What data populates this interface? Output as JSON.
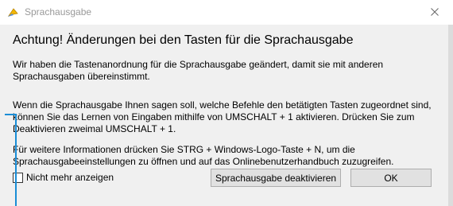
{
  "window": {
    "title": "Sprachausgabe",
    "icon": "narrator-app-icon",
    "close_icon": "close-icon"
  },
  "dialog": {
    "heading": "Achtung! Änderungen bei den Tasten für die Sprachausgabe",
    "paragraph1": "Wir haben die Tastenanordnung für die Sprachausgabe geändert, damit sie mit anderen Sprachausgaben übereinstimmt.",
    "paragraph2": "Wenn die Sprachausgabe Ihnen sagen soll, welche Befehle den betätigten Tasten zugeordnet sind, können Sie das Lernen von Eingaben mithilfe von UMSCHALT + 1 aktivieren. Drücken Sie zum Deaktivieren zweimal UMSCHALT + 1.",
    "paragraph3": "Für weitere Informationen drücken Sie STRG + Windows-Logo-Taste + N, um die Sprachausgabeeinstellungen zu öffnen und auf das Onlinebenutzerhandbuch zuzugreifen.",
    "checkbox_label": "Nicht mehr anzeigen",
    "checkbox_checked": false,
    "deactivate_button": "Sprachausgabe deaktivieren",
    "ok_button": "OK"
  },
  "colors": {
    "accent": "#1a8dd6",
    "dialog_bg": "#f0f0f0",
    "button_bg": "#e1e1e1"
  }
}
